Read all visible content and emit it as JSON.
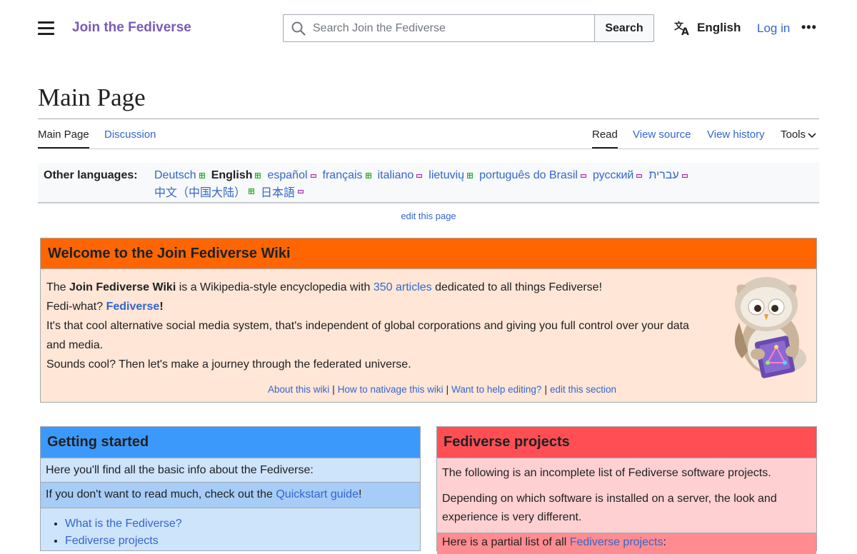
{
  "header": {
    "site_name": "Join the Fediverse",
    "search_placeholder": "Search Join the Fediverse",
    "search_button": "Search",
    "language": "English",
    "login": "Log in",
    "more": "•••"
  },
  "page": {
    "title": "Main Page",
    "tabs_left": [
      "Main Page",
      "Discussion"
    ],
    "tabs_right": [
      "Read",
      "View source",
      "View history",
      "Tools"
    ]
  },
  "languages": {
    "label": "Other languages:",
    "row1": [
      {
        "name": "Deutsch",
        "status": "full"
      },
      {
        "name": "English",
        "status": "full",
        "current": true
      },
      {
        "name": "español",
        "status": "partial"
      },
      {
        "name": "français",
        "status": "full"
      },
      {
        "name": "italiano",
        "status": "partial"
      },
      {
        "name": "lietuvių",
        "status": "full"
      },
      {
        "name": "português do Brasil",
        "status": "partial"
      },
      {
        "name": "русский",
        "status": "partial"
      },
      {
        "name": "עברית",
        "status": "partial"
      }
    ],
    "row2": [
      {
        "name": "中文（中国大陆）",
        "status": "full"
      },
      {
        "name": "日本語",
        "status": "partial"
      }
    ]
  },
  "edit_page": "edit this page",
  "welcome": {
    "heading": "Welcome to the Join Fediverse Wiki",
    "line1_pre": "The ",
    "line1_bold": "Join Fediverse Wiki",
    "line1_mid": " is a Wikipedia-style encyclopedia with ",
    "line1_link": "350 articles",
    "line1_post": " dedicated to all things Fediverse!",
    "line2_pre": "Fedi-what? ",
    "line2_link": "Fediverse",
    "line2_post": "!",
    "line3": "It's that cool alternative social media system, that's independent of global corporations and giving you full control over your data and media.",
    "line4": "Sounds cool? Then let's make a journey through the federated universe.",
    "links": [
      "About this wiki",
      "How to nativage this wiki",
      "Want to help editing?",
      "edit this section"
    ],
    "separator": "|"
  },
  "getting_started": {
    "heading": "Getting started",
    "row1": "Here you'll find all the basic info about the Fediverse:",
    "row2_pre": "If you don't want to read much, check out the ",
    "row2_link": "Quickstart guide",
    "row2_post": "!",
    "items": [
      "What is the Fediverse?",
      "Fediverse projects"
    ]
  },
  "fediverse_projects": {
    "heading": "Fediverse projects",
    "p1": "The following is an incomplete list of Fediverse software projects.",
    "p2": "Depending on which software is installed on a server, the look and experience is very different.",
    "strip_pre": "Here is a partial list of all ",
    "strip_link": "Fediverse projects",
    "strip_post": ":"
  },
  "colors": {
    "brand": "#7b5bb6",
    "link": "#3366cc",
    "welcome_header": "#ff6602",
    "welcome_body": "#ffe6d6",
    "getting_started_header": "#3c99fc",
    "projects_header": "#ff4f55"
  }
}
